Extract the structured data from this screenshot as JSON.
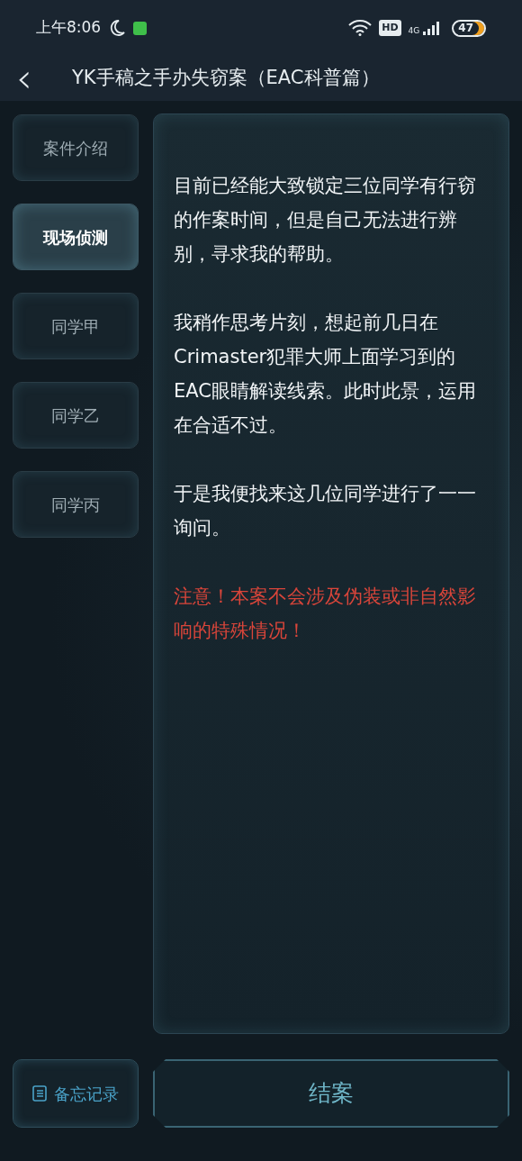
{
  "status_bar": {
    "time": "上午8:06",
    "hd_label": "HD",
    "network": "4G",
    "battery": "47"
  },
  "header": {
    "back": "‹",
    "title": "YK手稿之手办失窃案（EAC科普篇）"
  },
  "sidebar": {
    "items": [
      {
        "label": "案件介绍",
        "selected": false
      },
      {
        "label": "现场侦测",
        "selected": true
      },
      {
        "label": "同学甲",
        "selected": false
      },
      {
        "label": "同学乙",
        "selected": false
      },
      {
        "label": "同学丙",
        "selected": false
      }
    ]
  },
  "content": {
    "paragraphs": [
      {
        "kind": "normal",
        "text": "目前已经能大致锁定三位同学有行窃的作案时间，但是自己无法进行辨别，寻求我的帮助。"
      },
      {
        "kind": "normal",
        "text": "我稍作思考片刻，想起前几日在Crimaster犯罪大师上面学习到的EAC眼睛解读线索。此时此景，运用在合适不过。"
      },
      {
        "kind": "normal",
        "text": "于是我便找来这几位同学进行了一一询问。"
      },
      {
        "kind": "warning",
        "text": "注意！本案不会涉及伪装或非自然影响的特殊情况！"
      }
    ]
  },
  "footer": {
    "notes_button": "备忘记录",
    "close_case_button": "结案"
  }
}
